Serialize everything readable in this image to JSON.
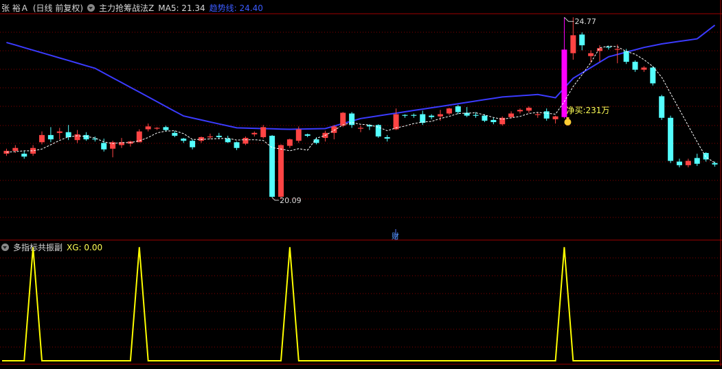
{
  "header1": {
    "stock_name": "张 裕Ａ",
    "period": "(日线 前复权)",
    "indicator": "主力抢筹战法Z",
    "ma5_label": "MA5: 21.34",
    "trend_label": "趋势线: 24.40"
  },
  "header2": {
    "indicator": "多指标共振副",
    "xg_label": "XG: 0.00"
  },
  "annotations": {
    "high": "24.77",
    "low": "20.09",
    "net_buy": "净买:231万",
    "fin_marker": "财"
  },
  "colors": {
    "up": "#ff4444",
    "down": "#54ffff",
    "trend": "#3b3bff",
    "ma": "#ffffff",
    "signal_bar": "#ff00ff",
    "sub_line": "#ffff00",
    "grid": "#8b0000",
    "border": "#a00000"
  },
  "chart_data": [
    {
      "type": "candlestick",
      "price_range": [
        19.2,
        25.2
      ],
      "candles": [
        [
          21.3,
          21.38,
          21.24,
          21.44
        ],
        [
          21.38,
          21.46,
          21.32,
          21.54
        ],
        [
          21.3,
          21.22,
          21.16,
          21.38
        ],
        [
          21.3,
          21.46,
          21.24,
          21.54
        ],
        [
          21.62,
          21.82,
          21.56,
          21.92
        ],
        [
          21.82,
          21.7,
          21.62,
          22.04
        ],
        [
          21.88,
          21.92,
          21.7,
          22.02
        ],
        [
          21.9,
          21.76,
          21.68,
          22.1
        ],
        [
          21.68,
          21.84,
          21.6,
          21.96
        ],
        [
          21.82,
          21.7,
          21.66,
          21.9
        ],
        [
          21.72,
          21.7,
          21.64,
          21.78
        ],
        [
          21.6,
          21.42,
          21.36,
          21.72
        ],
        [
          21.44,
          21.62,
          21.2,
          21.66
        ],
        [
          21.54,
          21.62,
          21.46,
          21.74
        ],
        [
          21.58,
          21.64,
          21.5,
          21.66
        ],
        [
          21.62,
          21.92,
          21.62,
          21.98
        ],
        [
          21.98,
          22.06,
          21.92,
          22.14
        ],
        [
          22.0,
          22.02,
          21.96,
          22.04
        ],
        [
          22.04,
          21.96,
          21.92,
          22.08
        ],
        [
          21.88,
          21.8,
          21.76,
          21.94
        ],
        [
          21.72,
          21.66,
          21.6,
          21.74
        ],
        [
          21.66,
          21.48,
          21.42,
          21.7
        ],
        [
          21.66,
          21.76,
          21.6,
          21.78
        ],
        [
          21.76,
          21.78,
          21.7,
          21.86
        ],
        [
          21.8,
          21.76,
          21.72,
          21.88
        ],
        [
          21.72,
          21.62,
          21.6,
          21.8
        ],
        [
          21.62,
          21.46,
          21.4,
          21.64
        ],
        [
          21.58,
          21.74,
          21.54,
          21.78
        ],
        [
          21.84,
          21.88,
          21.78,
          21.92
        ],
        [
          21.76,
          22.04,
          21.72,
          22.1
        ],
        [
          21.8,
          20.1,
          20.08,
          21.82
        ],
        [
          20.1,
          21.54,
          20.04,
          21.56
        ],
        [
          21.52,
          21.7,
          21.46,
          21.72
        ],
        [
          21.66,
          21.98,
          21.6,
          22.06
        ],
        [
          21.84,
          21.8,
          21.76,
          21.86
        ],
        [
          21.7,
          21.6,
          21.56,
          21.76
        ],
        [
          21.74,
          21.88,
          21.64,
          21.94
        ],
        [
          21.88,
          22.06,
          21.7,
          22.1
        ],
        [
          22.08,
          22.44,
          22.04,
          22.46
        ],
        [
          22.42,
          22.1,
          22.02,
          22.46
        ],
        [
          22.0,
          22.02,
          21.9,
          22.08
        ],
        [
          22.1,
          22.06,
          21.96,
          22.12
        ],
        [
          22.1,
          21.78,
          21.74,
          22.12
        ],
        [
          21.76,
          21.72,
          21.64,
          21.82
        ],
        [
          21.98,
          22.4,
          21.96,
          22.56
        ],
        [
          22.38,
          22.36,
          22.3,
          22.4
        ],
        [
          22.38,
          22.36,
          22.3,
          22.42
        ],
        [
          22.4,
          22.16,
          22.1,
          22.5
        ],
        [
          22.36,
          22.32,
          22.26,
          22.4
        ],
        [
          22.34,
          22.4,
          22.22,
          22.52
        ],
        [
          22.42,
          22.56,
          22.38,
          22.58
        ],
        [
          22.62,
          22.46,
          22.4,
          22.66
        ],
        [
          22.44,
          22.36,
          22.32,
          22.6
        ],
        [
          22.38,
          22.36,
          22.3,
          22.46
        ],
        [
          22.36,
          22.22,
          22.18,
          22.4
        ],
        [
          22.24,
          22.18,
          22.12,
          22.3
        ],
        [
          22.12,
          22.3,
          22.08,
          22.34
        ],
        [
          22.32,
          22.42,
          22.28,
          22.48
        ],
        [
          22.48,
          22.52,
          22.42,
          22.56
        ],
        [
          22.5,
          22.58,
          22.44,
          22.62
        ],
        [
          22.4,
          22.4,
          22.3,
          22.46
        ],
        [
          22.48,
          22.28,
          22.22,
          22.56
        ],
        [
          22.26,
          22.34,
          22.14,
          22.36
        ],
        [
          22.32,
          24.2,
          22.28,
          25.1
        ],
        [
          24.1,
          24.6,
          23.92,
          25.1
        ],
        [
          24.62,
          24.32,
          24.18,
          24.68
        ],
        [
          24.02,
          24.1,
          23.84,
          24.18
        ],
        [
          24.16,
          24.24,
          23.86,
          24.32
        ],
        [
          24.28,
          24.26,
          24.2,
          24.3
        ],
        [
          24.2,
          24.22,
          23.82,
          24.34
        ],
        [
          24.16,
          23.86,
          23.8,
          24.22
        ],
        [
          23.86,
          23.64,
          23.58,
          23.9
        ],
        [
          23.64,
          23.7,
          23.58,
          23.74
        ],
        [
          23.7,
          23.26,
          23.2,
          23.74
        ],
        [
          22.9,
          22.3,
          22.24,
          22.94
        ],
        [
          22.3,
          21.1,
          21.04,
          22.36
        ],
        [
          21.08,
          20.98,
          20.92,
          21.16
        ],
        [
          20.98,
          21.1,
          20.92,
          21.16
        ],
        [
          21.18,
          21.02,
          20.96,
          21.3
        ],
        [
          21.32,
          21.14,
          21.08,
          21.34
        ],
        [
          21.04,
          21.0,
          20.94,
          21.08
        ]
      ],
      "ma5": [
        21.34,
        21.36,
        21.38,
        21.38,
        21.43,
        21.55,
        21.67,
        21.77,
        21.8,
        21.78,
        21.74,
        21.63,
        21.58,
        21.61,
        21.61,
        21.66,
        21.75,
        21.88,
        21.93,
        21.94,
        21.86,
        21.7,
        21.7,
        21.71,
        21.72,
        21.73,
        21.68,
        21.69,
        21.69,
        21.67,
        21.47,
        21.43,
        21.38,
        21.44,
        21.4,
        21.73,
        21.81,
        21.95,
        22.1,
        22.17,
        22.12,
        22.1,
        22.04,
        21.94,
        22.02,
        22.07,
        22.14,
        22.18,
        22.2,
        22.28,
        22.34,
        22.42,
        22.43,
        22.44,
        22.38,
        22.31,
        22.26,
        22.3,
        22.34,
        22.42,
        22.45,
        22.43,
        22.4,
        22.75,
        23.17,
        23.5,
        23.84,
        24.25,
        24.3,
        24.28,
        24.15,
        24.07,
        23.92,
        23.73,
        23.43,
        22.98,
        22.53,
        22.08,
        21.63,
        21.2,
        21.05
      ],
      "trend": [
        [
          0,
          24.4
        ],
        [
          10,
          23.68
        ],
        [
          20,
          22.35
        ],
        [
          26,
          22.02
        ],
        [
          32,
          21.98
        ],
        [
          36,
          22.0
        ],
        [
          40,
          22.28
        ],
        [
          48,
          22.58
        ],
        [
          56,
          22.88
        ],
        [
          60,
          22.95
        ],
        [
          62,
          22.86
        ],
        [
          64,
          23.4
        ],
        [
          68,
          24.0
        ],
        [
          72,
          24.26
        ],
        [
          74,
          24.36
        ],
        [
          78,
          24.5
        ],
        [
          80,
          24.88
        ]
      ],
      "annotate": {
        "high_idx": 63,
        "low_idx": 30,
        "net_buy_idx": 63
      }
    },
    {
      "type": "line",
      "ylim": [
        0,
        1.05
      ],
      "pulses": [
        3,
        15,
        32,
        63
      ],
      "n": 81
    }
  ]
}
